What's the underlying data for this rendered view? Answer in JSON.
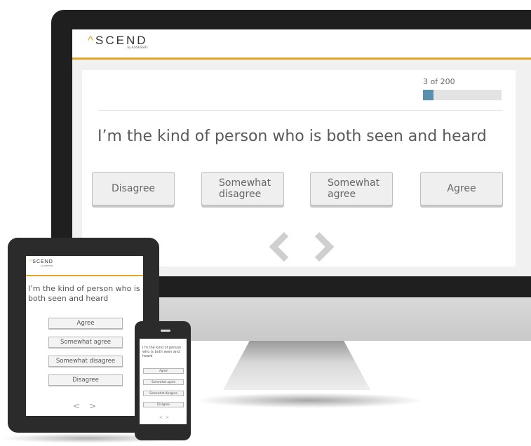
{
  "brand": {
    "logo_caret": "^",
    "logo_word": "SCEND",
    "logo_sub": "by ASSESSIO",
    "accent_color": "#e0a52b",
    "progress_color": "#5a8fad"
  },
  "desktop": {
    "progress_label": "3 of 200",
    "progress_fraction": 0.13,
    "question": "I’m the kind of person who is both seen and heard",
    "options": [
      "Disagree",
      "Somewhat\ndisagree",
      "Somewhat\nagree",
      "Agree"
    ],
    "nav": {
      "prev_icon": "chevron-left-icon",
      "next_icon": "chevron-right-icon"
    }
  },
  "tablet": {
    "question": "I’m the kind of person who is both seen and heard",
    "options": [
      "Agree",
      "Somewhat agree",
      "Somewhat disagree",
      "Disagree"
    ],
    "prev": "<",
    "next": ">"
  },
  "phone": {
    "question": "I’m the kind of person who is both seen and heard",
    "options": [
      "Agree",
      "Somewhat agree",
      "Somewhat disagree",
      "Disagree"
    ],
    "prev": "<",
    "next": ">"
  }
}
